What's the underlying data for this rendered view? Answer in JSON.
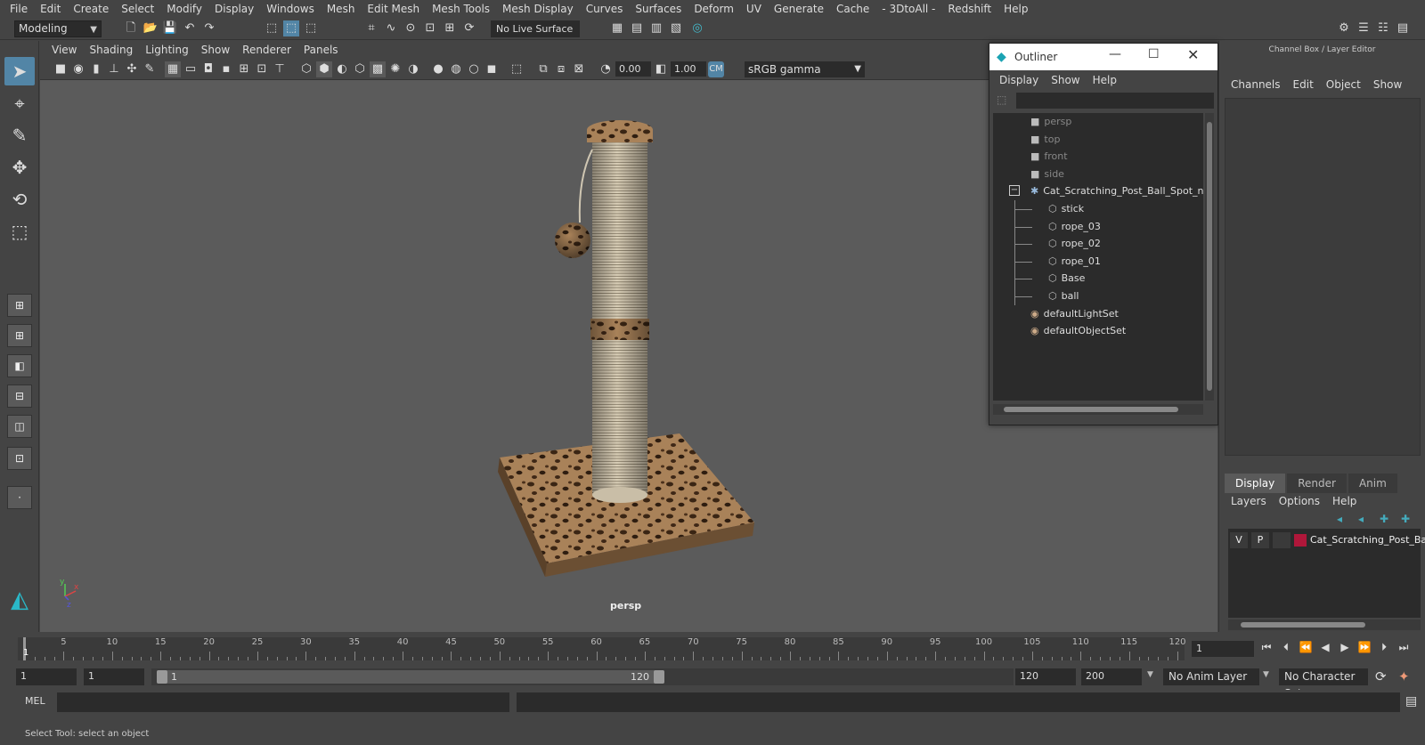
{
  "menubar": {
    "items": [
      "File",
      "Edit",
      "Create",
      "Select",
      "Modify",
      "Display",
      "Windows",
      "Mesh",
      "Edit Mesh",
      "Mesh Tools",
      "Mesh Display",
      "Curves",
      "Surfaces",
      "Deform",
      "UV",
      "Generate",
      "Cache",
      "- 3DtoAll -",
      "Redshift",
      "Help"
    ]
  },
  "statusline": {
    "mode": "Modeling",
    "live_surface": "No Live Surface"
  },
  "viewport": {
    "menu": [
      "View",
      "Shading",
      "Lighting",
      "Show",
      "Renderer",
      "Panels"
    ],
    "exposure": "0.00",
    "gamma": "1.00",
    "color_space": "sRGB gamma",
    "camera_label": "persp",
    "axis_y": "y",
    "axis_x": "x",
    "axis_z": "z"
  },
  "outliner": {
    "title": "Outliner",
    "menu": [
      "Display",
      "Show",
      "Help"
    ],
    "items": [
      {
        "label": "persp",
        "type": "camera",
        "depth": 0,
        "dim": true
      },
      {
        "label": "top",
        "type": "camera",
        "depth": 0,
        "dim": true
      },
      {
        "label": "front",
        "type": "camera",
        "depth": 0,
        "dim": true
      },
      {
        "label": "side",
        "type": "camera",
        "depth": 0,
        "dim": true
      },
      {
        "label": "Cat_Scratching_Post_Ball_Spot_ncl",
        "type": "group",
        "depth": 0,
        "dim": false
      },
      {
        "label": "stick",
        "type": "mesh",
        "depth": 1,
        "dim": false
      },
      {
        "label": "rope_03",
        "type": "mesh",
        "depth": 1,
        "dim": false
      },
      {
        "label": "rope_02",
        "type": "mesh",
        "depth": 1,
        "dim": false
      },
      {
        "label": "rope_01",
        "type": "mesh",
        "depth": 1,
        "dim": false
      },
      {
        "label": "Base",
        "type": "mesh",
        "depth": 1,
        "dim": false
      },
      {
        "label": "ball",
        "type": "mesh",
        "depth": 1,
        "dim": false
      },
      {
        "label": "defaultLightSet",
        "type": "set",
        "depth": 0,
        "dim": false
      },
      {
        "label": "defaultObjectSet",
        "type": "set",
        "depth": 0,
        "dim": false
      }
    ]
  },
  "channelbox": {
    "header": "Channel Box / Layer Editor",
    "menu": [
      "Channels",
      "Edit",
      "Object",
      "Show"
    ]
  },
  "layereditor": {
    "tabs": [
      "Display",
      "Render",
      "Anim"
    ],
    "active_tab": "Display",
    "menu": [
      "Layers",
      "Options",
      "Help"
    ],
    "layer": {
      "v": "V",
      "p": "P",
      "name": "Cat_Scratching_Post_Ball",
      "color": "#b0173a"
    }
  },
  "timeline": {
    "current_frame_label": "1",
    "ticks": [
      "5",
      "10",
      "15",
      "20",
      "25",
      "30",
      "35",
      "40",
      "45",
      "50",
      "55",
      "60",
      "65",
      "70",
      "75",
      "80",
      "85",
      "90",
      "95",
      "100",
      "105",
      "110",
      "115",
      "120"
    ],
    "current_frame_field": "1"
  },
  "range": {
    "start": "1",
    "playback_start": "1",
    "slider_start": "1",
    "slider_end": "120",
    "playback_end": "120",
    "end": "200",
    "anim_layer": "No Anim Layer",
    "character_set": "No Character Set"
  },
  "cmdline": {
    "label": "MEL"
  },
  "helpline": {
    "text": "Select Tool: select an object"
  }
}
